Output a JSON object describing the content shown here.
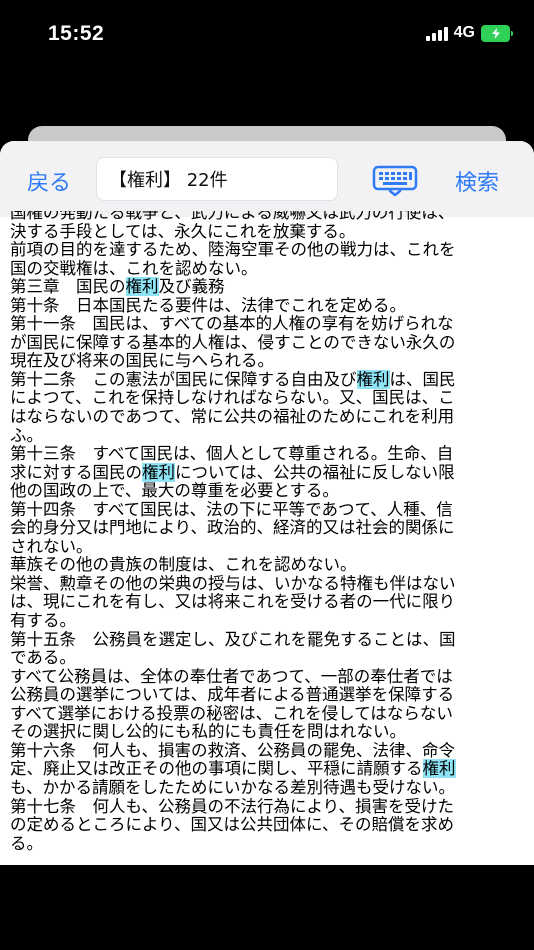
{
  "status_bar": {
    "time": "15:52",
    "network": "4G",
    "battery_color": "#30d158"
  },
  "toolbar": {
    "back_label": "戻る",
    "search_query": "【権利】 22件",
    "keyboard_icon": "keyboard-icon",
    "search_label": "検索",
    "accent_color": "#2f7bf6"
  },
  "document": {
    "highlight_color": "#8ee3f5",
    "lines": [
      [
        {
          "t": "国権の発動たる戦争と、武力による威嚇又は武力の行使は、"
        }
      ],
      [
        {
          "t": "決する手段としては、永久にこれを放棄する。"
        }
      ],
      [
        {
          "t": "前項の目的を達するため、陸海空軍その他の戦力は、これを"
        }
      ],
      [
        {
          "t": "国の交戦権は、これを認めない。"
        }
      ],
      [
        {
          "t": "第三章　国民の"
        },
        {
          "t": "権利",
          "h": true
        },
        {
          "t": "及び義務"
        }
      ],
      [
        {
          "t": "第十条　日本国民たる要件は、法律でこれを定める。"
        }
      ],
      [
        {
          "t": "第十一条　国民は、すべての基本的人権の享有を妨げられな"
        }
      ],
      [
        {
          "t": "が国民に保障する基本的人権は、侵すことのできない永久の"
        }
      ],
      [
        {
          "t": "現在及び将来の国民に与へられる。"
        }
      ],
      [
        {
          "t": "第十二条　この憲法が国民に保障する自由及び"
        },
        {
          "t": "権利",
          "h": true
        },
        {
          "t": "は、国民"
        }
      ],
      [
        {
          "t": "によつて、これを保持しなければならない。又、国民は、こ"
        }
      ],
      [
        {
          "t": "はならないのであつて、常に公共の福祉のためにこれを利用"
        }
      ],
      [
        {
          "t": "ふ。"
        }
      ],
      [
        {
          "t": "第十三条　すべて国民は、個人として尊重される。生命、自"
        }
      ],
      [
        {
          "t": "求に対する国民の"
        },
        {
          "t": "権利",
          "h": true
        },
        {
          "t": "については、公共の福祉に反しない限"
        }
      ],
      [
        {
          "t": "他の国政の上で、最大の尊重を必要とする。"
        }
      ],
      [
        {
          "t": "第十四条　すべて国民は、法の下に平等であつて、人種、信"
        }
      ],
      [
        {
          "t": "会的身分又は門地により、政治的、経済的又は社会的関係に"
        }
      ],
      [
        {
          "t": "されない。"
        }
      ],
      [
        {
          "t": "華族その他の貴族の制度は、これを認めない。"
        }
      ],
      [
        {
          "t": "栄誉、勲章その他の栄典の授与は、いかなる特権も伴はない"
        }
      ],
      [
        {
          "t": "は、現にこれを有し、又は将来これを受ける者の一代に限り"
        }
      ],
      [
        {
          "t": "有する。"
        }
      ],
      [
        {
          "t": "第十五条　公務員を選定し、及びこれを罷免することは、国"
        }
      ],
      [
        {
          "t": "である。"
        }
      ],
      [
        {
          "t": "すべて公務員は、全体の奉仕者であつて、一部の奉仕者では"
        }
      ],
      [
        {
          "t": "公務員の選挙については、成年者による普通選挙を保障する"
        }
      ],
      [
        {
          "t": "すべて選挙における投票の秘密は、これを侵してはならない"
        }
      ],
      [
        {
          "t": "その選択に関し公的にも私的にも責任を問はれない。"
        }
      ],
      [
        {
          "t": "第十六条　何人も、損害の救済、公務員の罷免、法律、命令"
        }
      ],
      [
        {
          "t": "定、廃止又は改正その他の事項に関し、平穏に請願する"
        },
        {
          "t": "権利",
          "h": true
        }
      ],
      [
        {
          "t": "も、かかる請願をしたためにいかなる差別待遇も受けない。"
        }
      ],
      [
        {
          "t": "第十七条　何人も、公務員の不法行為により、損害を受けた"
        }
      ],
      [
        {
          "t": "の定めるところにより、国又は公共団体に、その賠償を求め"
        }
      ],
      [
        {
          "t": "る。"
        }
      ]
    ]
  }
}
